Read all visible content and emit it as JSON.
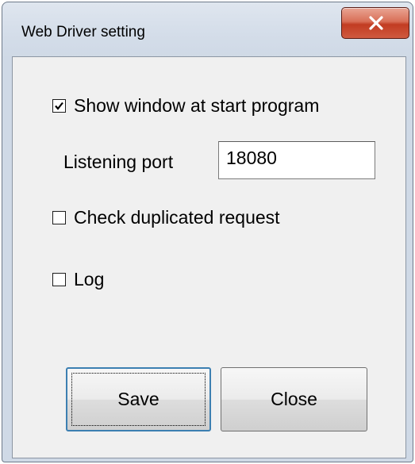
{
  "window": {
    "title": "Web Driver setting",
    "close_icon": "close-x-icon"
  },
  "settings": {
    "show_window": {
      "label": "Show window at start program",
      "checked": true
    },
    "listening_port": {
      "label": "Listening port",
      "value": "18080"
    },
    "check_duplicated": {
      "label": "Check duplicated request",
      "checked": false
    },
    "log": {
      "label": "Log",
      "checked": false
    }
  },
  "buttons": {
    "save_label": "Save",
    "close_label": "Close"
  },
  "colors": {
    "client_bg": "#f0f0f0",
    "close_button": "#c23c22",
    "focus_border": "#3c7fb1"
  }
}
